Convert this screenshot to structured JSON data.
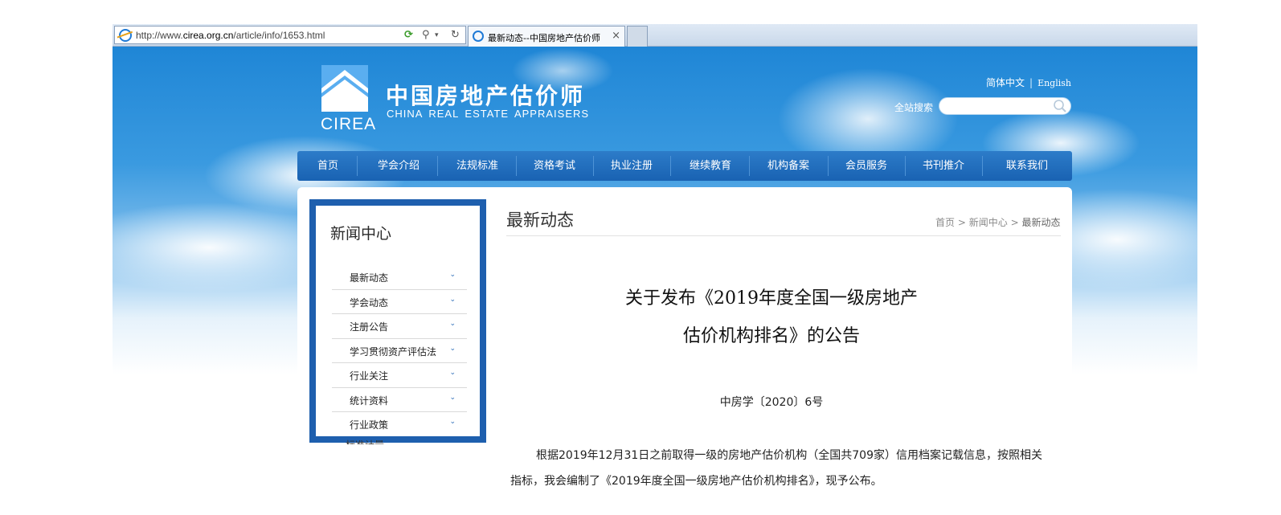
{
  "browser": {
    "url": "http://www.cirea.org.cn/article/info/1653.html",
    "url_prefix": "http://www.",
    "url_domain": "cirea.org.cn",
    "url_path": "/article/info/1653.html",
    "tab_title": "最新动态--中国房地产估价师",
    "close_glyph": "×"
  },
  "header": {
    "logo_text": "CIREA",
    "site_name": "中国房地产估价师",
    "site_name_en": "CHINA REAL ESTATE APPRAISERS",
    "lang_zh": "简体中文",
    "lang_sep": "|",
    "lang_en": "English",
    "search_label": "全站搜索",
    "search_value": ""
  },
  "nav": {
    "items": [
      "首页",
      "学会介绍",
      "法规标准",
      "资格考试",
      "执业注册",
      "继续教育",
      "机构备案",
      "会员服务",
      "书刊推介",
      "联系我们"
    ]
  },
  "sidebar": {
    "title": "新闻中心",
    "items": [
      "最新动态",
      "学会动态",
      "注册公告",
      "学习贯彻资产评估法",
      "行业关注",
      "统计资料",
      "行业政策"
    ],
    "clipped_item": "标准计量"
  },
  "content": {
    "section_title": "最新动态",
    "breadcrumb": {
      "home": "首页",
      "sep": ">",
      "parent": "新闻中心",
      "current": "最新动态"
    },
    "article_title_line1": "关于发布《2019年度全国一级房地产",
    "article_title_line2": "估价机构排名》的公告",
    "doc_number": "中房学〔2020〕6号",
    "body": "根据2019年12月31日之前取得一级的房地产估价机构（全国共709家）信用档案记载信息，按照相关指标，我会编制了《2019年度全国一级房地产估价机构排名》，现予公布。"
  },
  "colors": {
    "nav_blue": "#1962b2",
    "sidebar_frame": "#1e5fae",
    "chevron": "#2a6cb8"
  },
  "icons": [
    "ie-icon",
    "refresh-icon",
    "search-icon",
    "chevron-down-icon",
    "close-icon"
  ]
}
